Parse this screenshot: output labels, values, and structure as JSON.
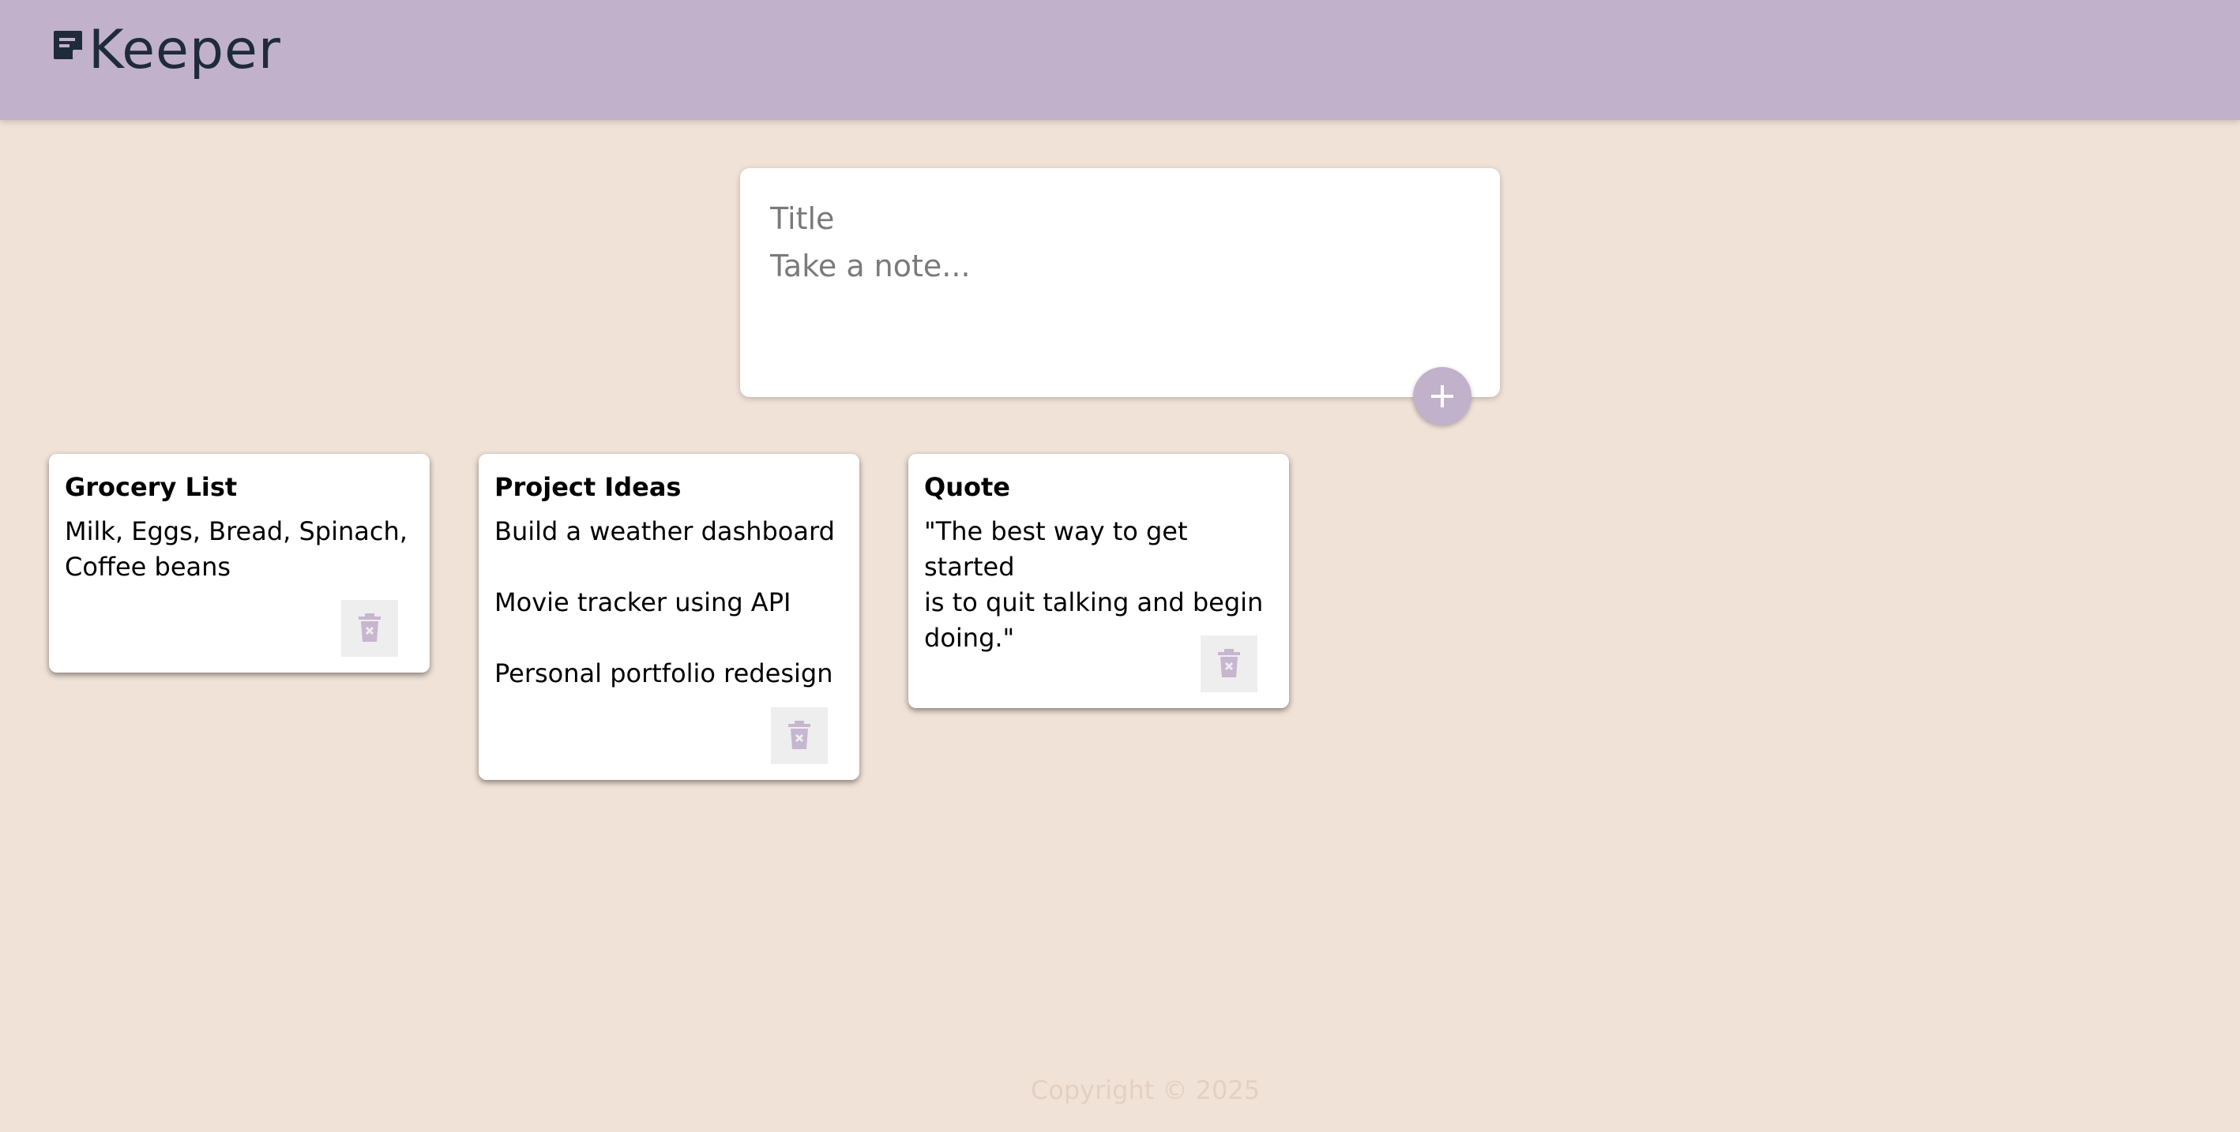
{
  "app": {
    "name": "Keeper",
    "logo_icon": "sticky-note-icon",
    "header_color": "#c2b1cb",
    "background_color": "#f0e2d6"
  },
  "create_note": {
    "title_placeholder": "Title",
    "content_placeholder": "Take a note...",
    "add_icon": "plus-icon"
  },
  "notes": [
    {
      "title": "Grocery List",
      "content": "Milk, Eggs, Bread, Spinach,\nCoffee beans",
      "delete_icon": "trash-icon"
    },
    {
      "title": "Project Ideas",
      "content": "Build a weather dashboard\n\nMovie tracker using API\n\nPersonal portfolio redesign",
      "delete_icon": "trash-icon"
    },
    {
      "title": "Quote",
      "content": "\"The best way to get started\nis to quit talking and begin\ndoing.\"",
      "delete_icon": "trash-icon"
    }
  ],
  "footer": {
    "copyright": "Copyright © 2025"
  }
}
